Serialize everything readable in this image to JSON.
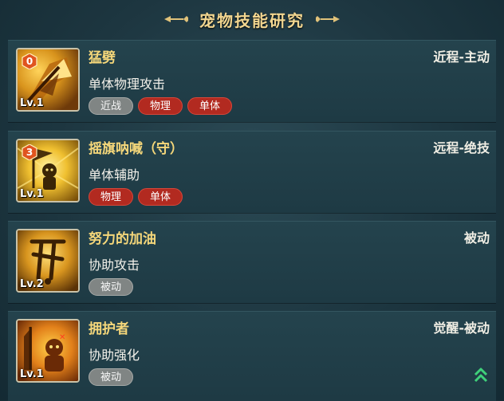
{
  "header": {
    "title": "宠物技能研究"
  },
  "skills": [
    {
      "cost": "0",
      "level": "Lv.1",
      "name": "猛劈",
      "type": "近程-主动",
      "desc": "单体物理攻击",
      "tags": [
        "近战",
        "物理",
        "单体"
      ]
    },
    {
      "cost": "3",
      "level": "Lv.1",
      "name": "摇旗呐喊（守）",
      "type": "远程-绝技",
      "desc": "单体辅助",
      "tags": [
        "物理",
        "单体"
      ]
    },
    {
      "level": "Lv.2",
      "name": "努力的加油",
      "type": "被动",
      "desc": "协助攻击",
      "tags": [
        "被动"
      ]
    },
    {
      "level": "Lv.1",
      "name": "拥护者",
      "type": "觉醒-被动",
      "desc": "协助强化",
      "tags": [
        "被动"
      ]
    }
  ],
  "colors": {
    "name": "#f5d77a",
    "tag_red": "#b22a20",
    "tag_gray": "#808584",
    "upgrade_arrow": "#3fd07a"
  },
  "icons": [
    "axe-skill-icon",
    "flag-skill-icon",
    "cheer-skill-icon",
    "guardian-skill-icon",
    "upgrade-arrow-icon"
  ]
}
